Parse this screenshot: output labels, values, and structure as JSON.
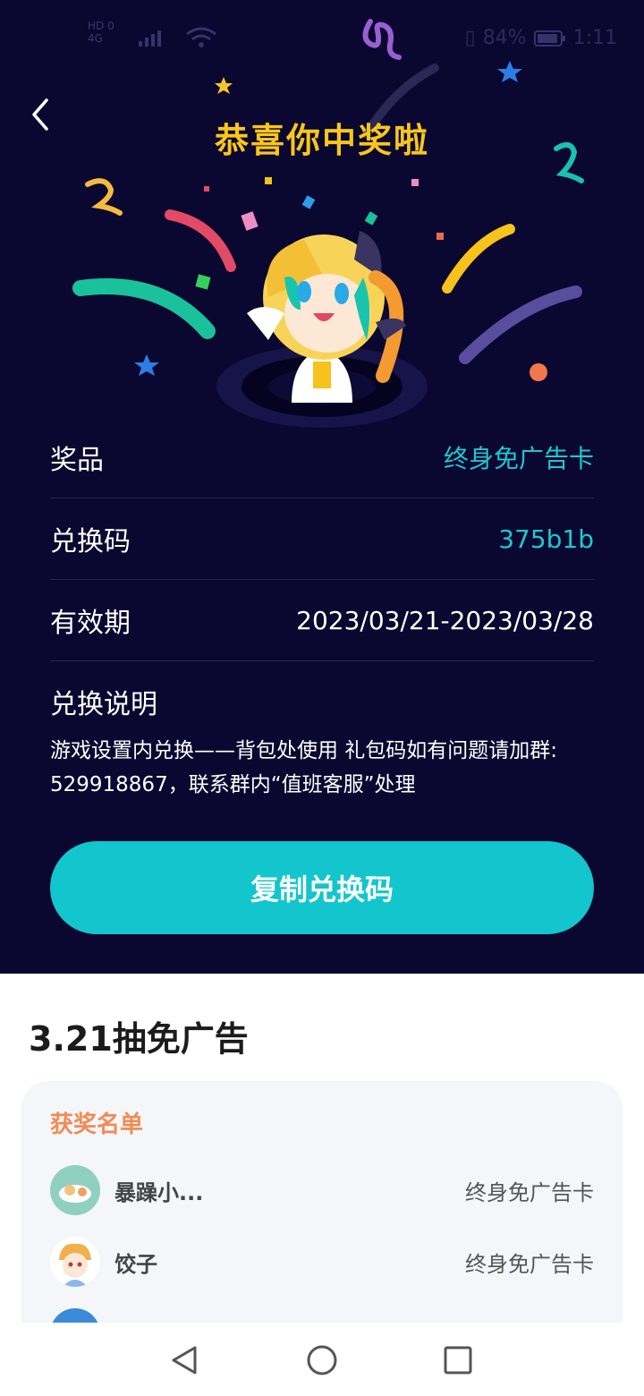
{
  "status_bar": {
    "carrier_top": "HD 0",
    "carrier_bottom": "4G",
    "battery_percent": "84%",
    "time": "1:11"
  },
  "header": {
    "title": "恭喜你中奖啦"
  },
  "details": {
    "prize_label": "奖品",
    "prize_value": "终身免广告卡",
    "code_label": "兑换码",
    "code_value": "375b1b",
    "validity_label": "有效期",
    "validity_value": "2023/03/21-2023/03/28",
    "notes_label": "兑换说明",
    "notes_line1": "游戏设置内兑换——背包处使用 礼包码如有问题请加群:",
    "notes_line2": "529918867，联系群内“值班客服”处理"
  },
  "copy_button": {
    "label": "复制兑换码"
  },
  "lottery": {
    "title": "3.21抽免广告",
    "list_heading": "获奖名单",
    "winners": [
      {
        "name": "暴躁小...",
        "prize": "终身免广告卡"
      },
      {
        "name": "饺子",
        "prize": "终身免广告卡"
      }
    ]
  },
  "colors": {
    "background_dark": "#0a0730",
    "accent_teal": "#13c5cd",
    "title_yellow": "#f8c61c",
    "heading_orange": "#f08c56"
  },
  "icons": [
    "back-chevron-icon",
    "app-logo-icon",
    "signal-icon",
    "wifi-icon",
    "battery-icon",
    "nav-back-icon",
    "nav-home-icon",
    "nav-recents-icon"
  ]
}
